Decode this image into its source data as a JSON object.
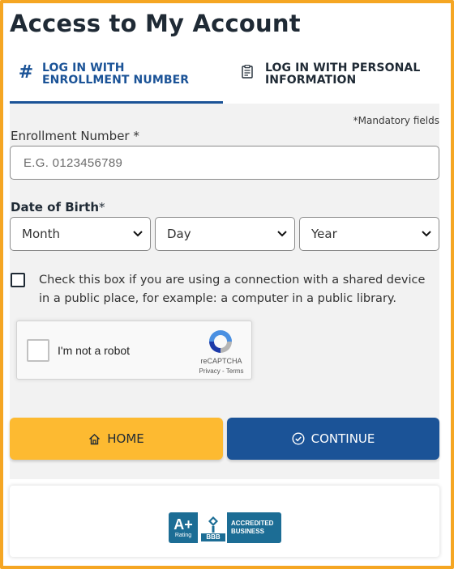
{
  "page": {
    "title": "Access to My Account"
  },
  "tabs": [
    {
      "label": "LOG IN WITH ENROLLMENT NUMBER",
      "icon": "hash-icon",
      "active": true
    },
    {
      "label": "LOG IN WITH PERSONAL INFORMATION",
      "icon": "document-icon",
      "active": false
    }
  ],
  "form": {
    "mandatory_note": "*Mandatory fields",
    "enrollment": {
      "label": "Enrollment Number",
      "required_mark": "*",
      "placeholder": "E.G. 0123456789",
      "value": ""
    },
    "dob": {
      "label": "Date of Birth",
      "required_mark": "*",
      "month": "Month",
      "day": "Day",
      "year": "Year"
    },
    "shared_device": {
      "checked": false,
      "text": "Check this box if you are using a connection with a shared device in a public place, for example: a computer in a public library."
    }
  },
  "captcha": {
    "label": "I'm not a robot",
    "brand": "reCAPTCHA",
    "privacy": "Privacy",
    "separator": "-",
    "terms": "Terms"
  },
  "buttons": {
    "home": "HOME",
    "continue": "CONTINUE"
  },
  "bbb": {
    "grade": "A+",
    "rating_word": "Rating",
    "acronym": "BBB",
    "accredited_line1": "ACCREDITED",
    "accredited_line2": "BUSINESS"
  },
  "colors": {
    "frame": "#f5a623",
    "primary": "#1b5397",
    "home_button": "#fdba31",
    "bbb_blue": "#1c6d95"
  }
}
